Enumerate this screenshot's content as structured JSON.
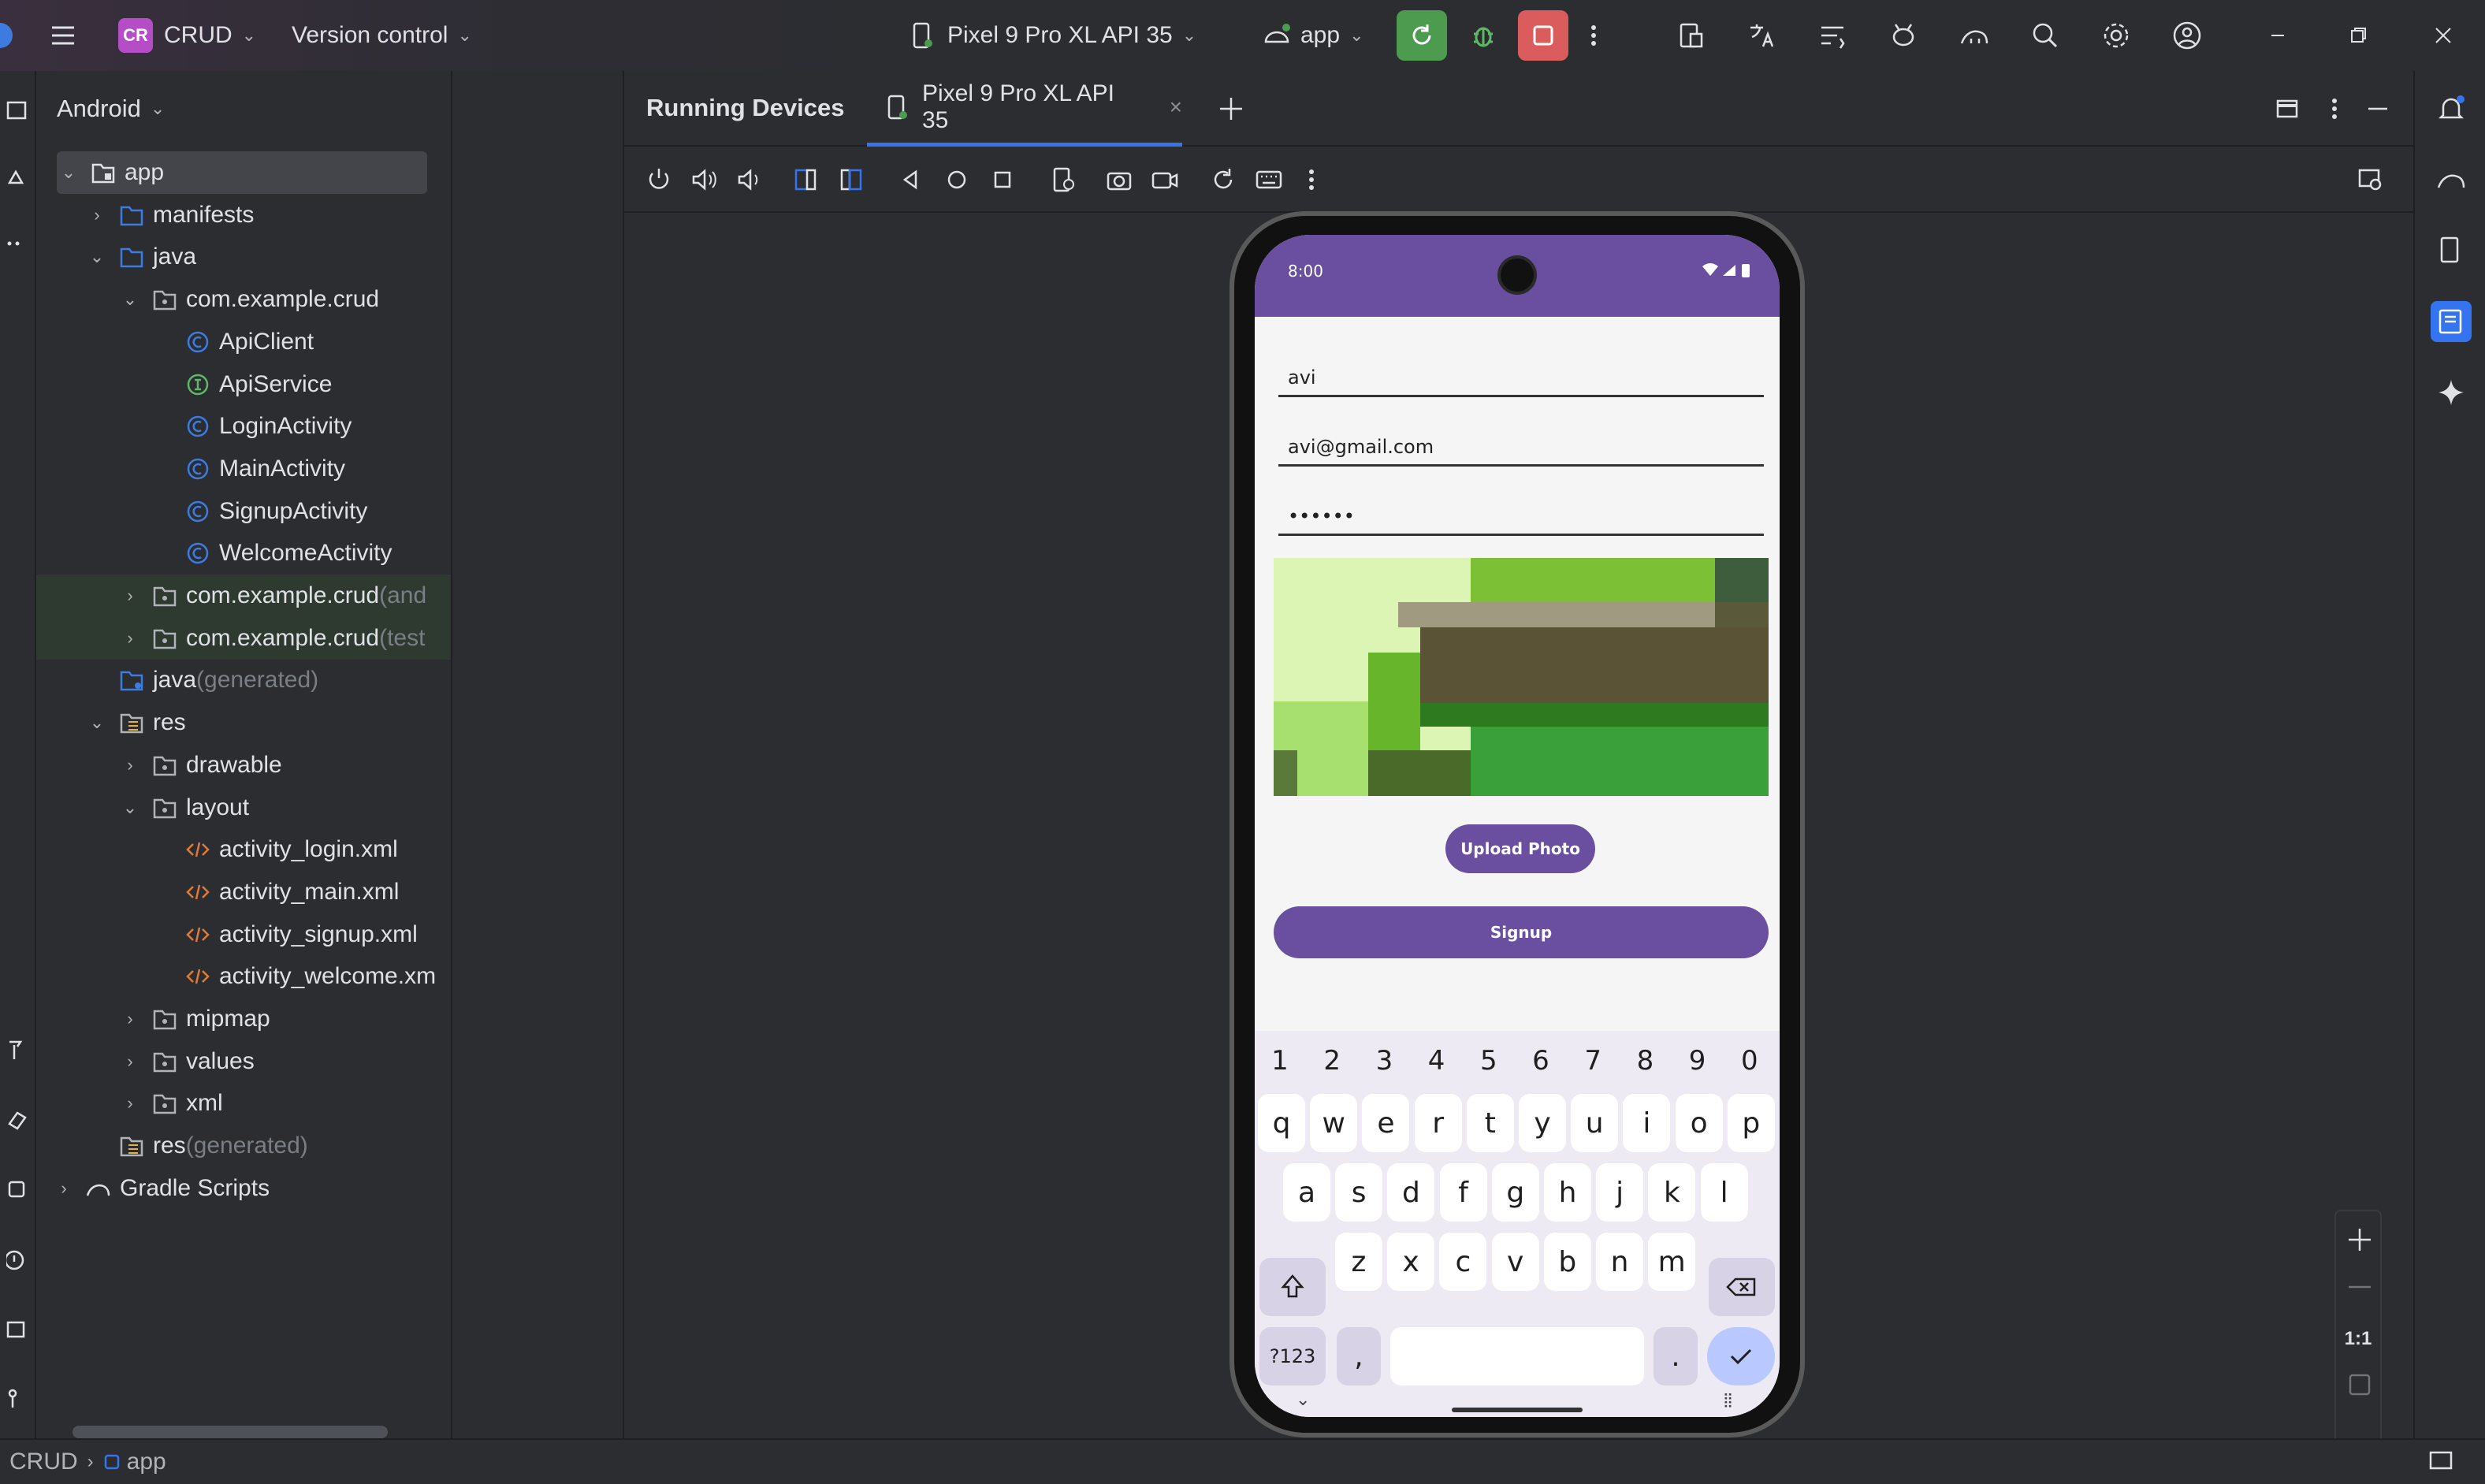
{
  "titlebar": {
    "project_badge": "CR",
    "project_name": "CRUD",
    "vcs_label": "Version control",
    "device_selector": "Pixel 9 Pro XL API 35",
    "run_config": "app"
  },
  "project_panel": {
    "view_label": "Android",
    "tree": [
      {
        "label": "app",
        "suffix": ""
      },
      {
        "label": "manifests",
        "suffix": ""
      },
      {
        "label": "java",
        "suffix": ""
      },
      {
        "label": "com.example.crud",
        "suffix": ""
      },
      {
        "label": "ApiClient",
        "suffix": ""
      },
      {
        "label": "ApiService",
        "suffix": ""
      },
      {
        "label": "LoginActivity",
        "suffix": ""
      },
      {
        "label": "MainActivity",
        "suffix": ""
      },
      {
        "label": "SignupActivity",
        "suffix": ""
      },
      {
        "label": "WelcomeActivity",
        "suffix": ""
      },
      {
        "label": "com.example.crud",
        "suffix": " (and"
      },
      {
        "label": "com.example.crud",
        "suffix": " (test"
      },
      {
        "label": "java",
        "suffix": " (generated)"
      },
      {
        "label": "res",
        "suffix": ""
      },
      {
        "label": "drawable",
        "suffix": ""
      },
      {
        "label": "layout",
        "suffix": ""
      },
      {
        "label": "activity_login.xml",
        "suffix": ""
      },
      {
        "label": "activity_main.xml",
        "suffix": ""
      },
      {
        "label": "activity_signup.xml",
        "suffix": ""
      },
      {
        "label": "activity_welcome.xm",
        "suffix": ""
      },
      {
        "label": "mipmap",
        "suffix": ""
      },
      {
        "label": "values",
        "suffix": ""
      },
      {
        "label": "xml",
        "suffix": ""
      },
      {
        "label": "res",
        "suffix": " (generated)"
      },
      {
        "label": "Gradle Scripts",
        "suffix": ""
      }
    ]
  },
  "devices": {
    "title": "Running Devices",
    "tab_label": "Pixel 9 Pro XL API 35",
    "zoom_label": "1:1"
  },
  "phone": {
    "time": "8:00",
    "name_value": "avi",
    "email_value": "avi@gmail.com",
    "password_value": "••••••",
    "upload_label": "Upload Photo",
    "signup_label": "Signup",
    "num_row": [
      "1",
      "2",
      "3",
      "4",
      "5",
      "6",
      "7",
      "8",
      "9",
      "0"
    ],
    "row1": [
      "q",
      "w",
      "e",
      "r",
      "t",
      "y",
      "u",
      "i",
      "o",
      "p"
    ],
    "row2": [
      "a",
      "s",
      "d",
      "f",
      "g",
      "h",
      "j",
      "k",
      "l"
    ],
    "row3": [
      "z",
      "x",
      "c",
      "v",
      "b",
      "n",
      "m"
    ],
    "sym_key": "?123",
    "comma_key": ",",
    "period_key": "."
  },
  "statusbar": {
    "crumb_project": "CRUD",
    "crumb_module": "app"
  },
  "colors": {
    "accent": "#3574f0",
    "run_green": "#4c9b4f",
    "stop_red": "#db5c5c",
    "app_purple": "#6a4fa0"
  }
}
